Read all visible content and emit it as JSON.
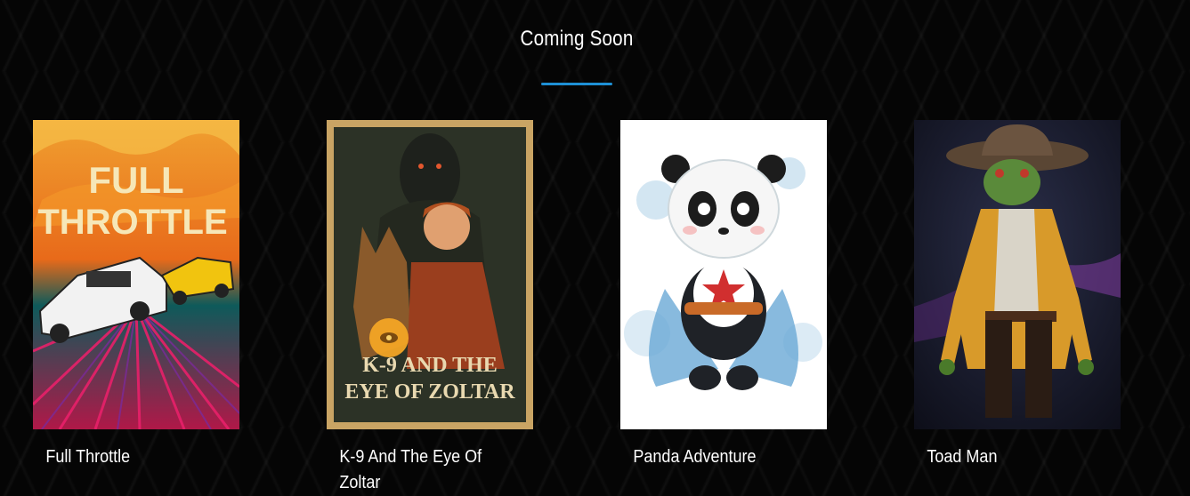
{
  "section": {
    "title": "Coming Soon",
    "accent_color": "#1e90d6"
  },
  "movies": [
    {
      "title": "Full Throttle",
      "poster_text": [
        "FULL",
        "THROTTLE"
      ]
    },
    {
      "title": "K-9 And The Eye Of Zoltar",
      "poster_text": [
        "K-9 AND THE",
        "EYE OF ZOLTAR"
      ]
    },
    {
      "title": "Panda Adventure",
      "poster_text": []
    },
    {
      "title": "Toad Man",
      "poster_text": []
    }
  ]
}
